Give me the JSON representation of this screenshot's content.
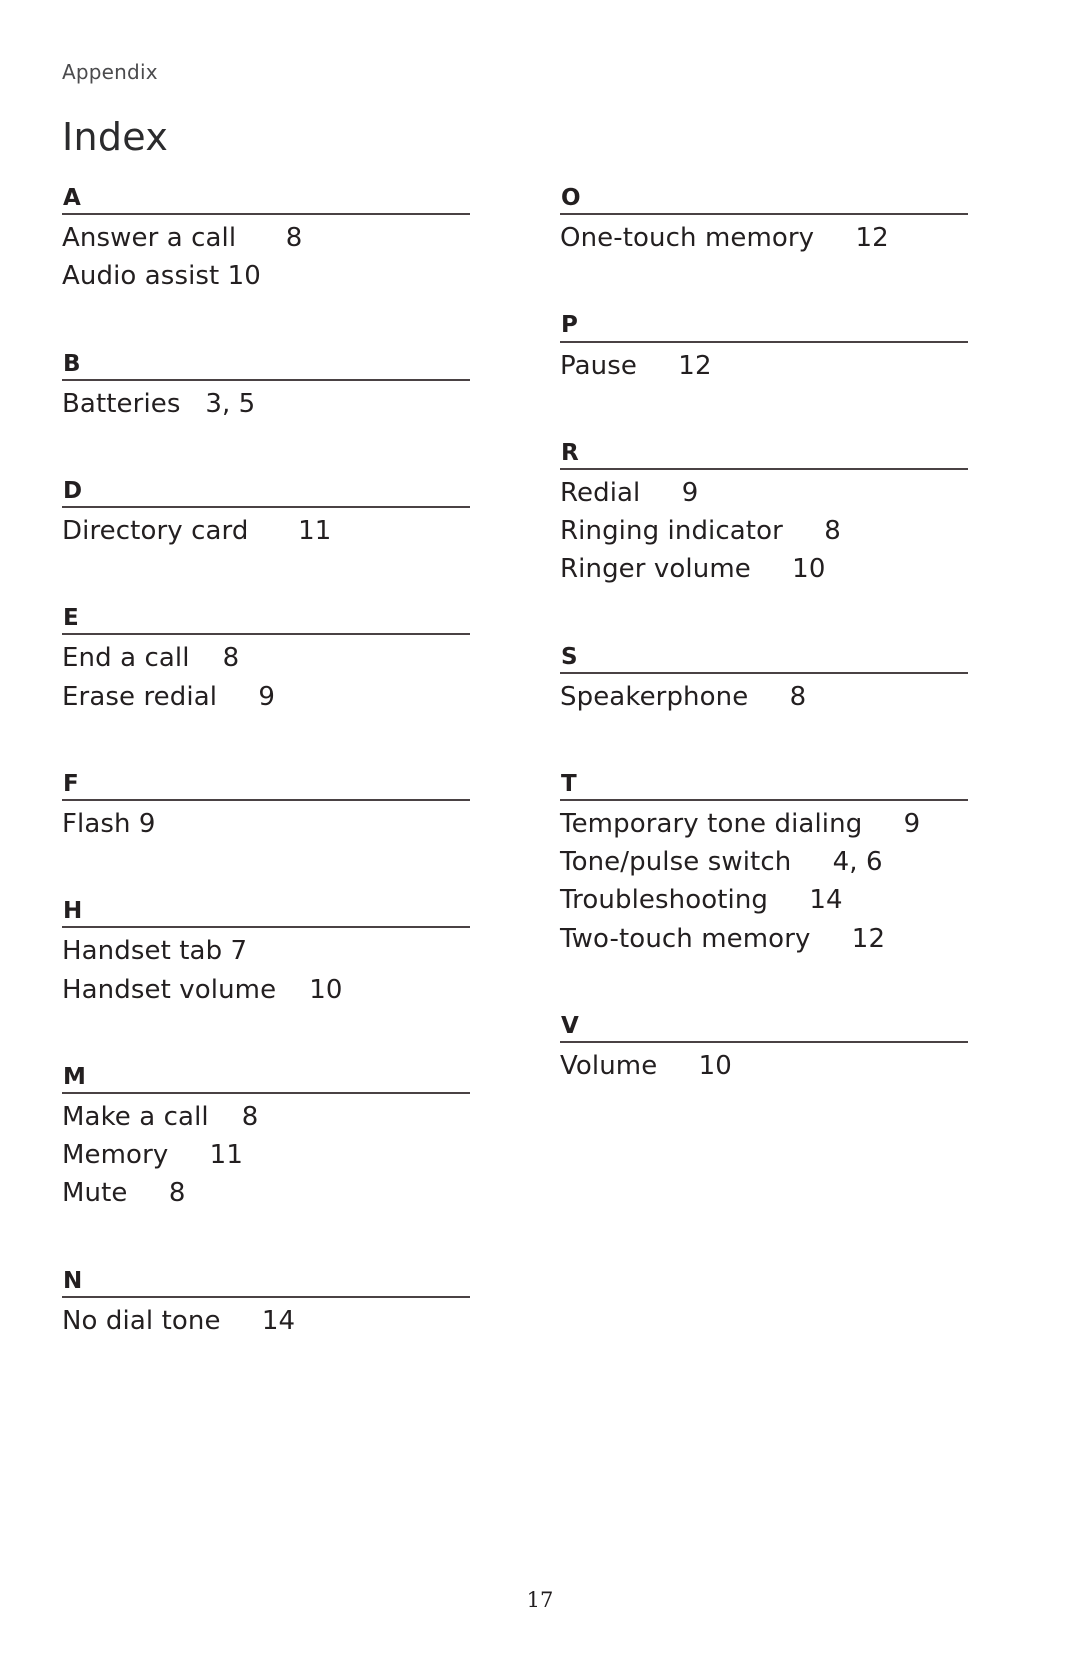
{
  "document": {
    "running_head": "Appendix",
    "title": "Index",
    "page_number": "17"
  },
  "index": {
    "left_column": [
      {
        "letter": "A",
        "entries": [
          {
            "term": "Answer a call",
            "gap": "      ",
            "page": "8"
          },
          {
            "term": "Audio assist",
            "gap": " ",
            "page": "10"
          }
        ]
      },
      {
        "letter": "B",
        "entries": [
          {
            "term": "Batteries",
            "gap": "   ",
            "page": "3, 5"
          }
        ]
      },
      {
        "letter": "D",
        "entries": [
          {
            "term": "Directory card",
            "gap": "      ",
            "page": "11"
          }
        ]
      },
      {
        "letter": "E",
        "entries": [
          {
            "term": "End a call",
            "gap": "    ",
            "page": "8"
          },
          {
            "term": "Erase redial",
            "gap": "     ",
            "page": "9"
          }
        ]
      },
      {
        "letter": "F",
        "entries": [
          {
            "term": "Flash",
            "gap": " ",
            "page": "9"
          }
        ]
      },
      {
        "letter": "H",
        "entries": [
          {
            "term": "Handset tab",
            "gap": " ",
            "page": "7"
          },
          {
            "term": "Handset volume",
            "gap": "    ",
            "page": "10"
          }
        ]
      },
      {
        "letter": "M",
        "entries": [
          {
            "term": "Make a call",
            "gap": "    ",
            "page": "8"
          },
          {
            "term": "Memory",
            "gap": "     ",
            "page": "11"
          },
          {
            "term": "Mute",
            "gap": "     ",
            "page": "8"
          }
        ]
      },
      {
        "letter": "N",
        "entries": [
          {
            "term": "No dial tone",
            "gap": "     ",
            "page": "14"
          }
        ]
      }
    ],
    "right_column": [
      {
        "letter": "O",
        "entries": [
          {
            "term": "One-touch memory",
            "gap": "     ",
            "page": "12"
          }
        ]
      },
      {
        "letter": "P",
        "entries": [
          {
            "term": "Pause",
            "gap": "     ",
            "page": "12"
          }
        ]
      },
      {
        "letter": "R",
        "entries": [
          {
            "term": "Redial",
            "gap": "     ",
            "page": "9"
          },
          {
            "term": "Ringing indicator",
            "gap": "     ",
            "page": "8"
          },
          {
            "term": "Ringer volume",
            "gap": "     ",
            "page": "10"
          }
        ]
      },
      {
        "letter": "S",
        "entries": [
          {
            "term": "Speakerphone",
            "gap": "     ",
            "page": "8"
          }
        ]
      },
      {
        "letter": "T",
        "entries": [
          {
            "term": "Temporary tone dialing",
            "gap": "     ",
            "page": "9"
          },
          {
            "term": "Tone/pulse switch",
            "gap": "     ",
            "page": "4, 6"
          },
          {
            "term": "Troubleshooting",
            "gap": "     ",
            "page": "14"
          },
          {
            "term": "Two-touch memory",
            "gap": "     ",
            "page": "12"
          }
        ]
      },
      {
        "letter": "V",
        "entries": [
          {
            "term": "Volume",
            "gap": "     ",
            "page": "10"
          }
        ]
      }
    ]
  }
}
